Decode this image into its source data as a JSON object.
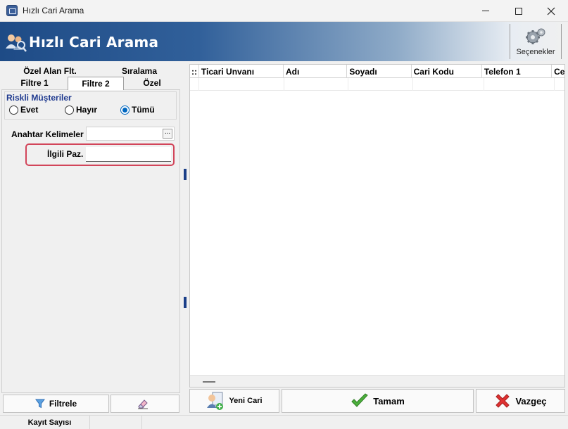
{
  "window": {
    "title": "Hızlı Cari Arama",
    "controls": [
      "minimize-icon",
      "maximize-icon",
      "close-icon"
    ]
  },
  "header": {
    "title": "Hızlı Cari Arama",
    "icon": "people-search-icon",
    "options_label": "Seçenekler",
    "options_icon": "gear-icon"
  },
  "tabs": {
    "row1": [
      "Özel Alan Flt.",
      "Sıralama"
    ],
    "row2": [
      "Filtre 1",
      "Filtre 2",
      "Özel"
    ],
    "active": "Filtre 2"
  },
  "filter2": {
    "risk_group_title": "Riskli Müşteriler",
    "radios": [
      {
        "label": "Evet",
        "selected": false
      },
      {
        "label": "Hayır",
        "selected": false
      },
      {
        "label": "Tümü",
        "selected": true
      }
    ],
    "keywords_label": "Anahtar Kelimeler",
    "keywords_value": "",
    "keywords_button": "...",
    "paz_label": "İlgili Paz.",
    "paz_value": ""
  },
  "grid": {
    "indicator": "::",
    "columns": [
      "Ticari Unvanı",
      "Adı",
      "Soyadı",
      "Cari Kodu",
      "Telefon 1",
      "Ce"
    ],
    "rows": []
  },
  "buttons": {
    "filter": "Filtrele",
    "new_account": "Yeni Cari",
    "ok": "Tamam",
    "cancel": "Vazgeç"
  },
  "status": {
    "record_count_label": "Kayıt Sayısı",
    "record_count_value": ""
  },
  "colors": {
    "banner_start": "#1e4b86",
    "group_title": "#1f3a8f",
    "highlight": "#d2455a",
    "radio_on": "#0067c0",
    "ok_check": "#4caf3d",
    "cancel_x": "#e03131"
  }
}
